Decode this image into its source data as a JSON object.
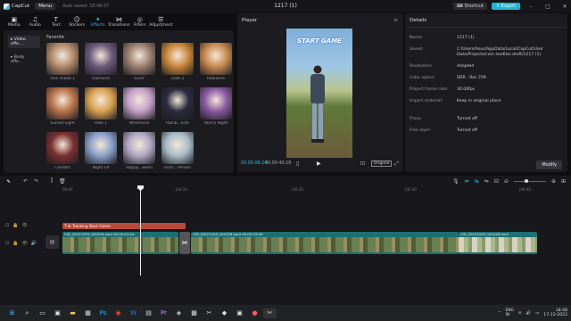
{
  "app": {
    "name": "CapCut",
    "menu_label": "Menu",
    "autosave": "Auto saved: 18:48:37",
    "window_title": "1217 (1)"
  },
  "titlebar": {
    "shortcut_label": "Shortcut",
    "export_label": "Export"
  },
  "toolbar": {
    "tools": [
      {
        "label": "Media",
        "icon": "media-icon"
      },
      {
        "label": "Audio",
        "icon": "audio-icon"
      },
      {
        "label": "Text",
        "icon": "text-icon"
      },
      {
        "label": "Stickers",
        "icon": "stickers-icon"
      },
      {
        "label": "Effects",
        "icon": "effects-icon",
        "active": true
      },
      {
        "label": "Transitions",
        "icon": "transitions-icon"
      },
      {
        "label": "Filters",
        "icon": "filters-icon"
      },
      {
        "label": "Adjustment",
        "icon": "adjustment-icon"
      }
    ]
  },
  "media_panel": {
    "side_items": [
      {
        "label": "▸ Video effe...",
        "active": true
      },
      {
        "label": "▸ Body effe...",
        "active": false
      }
    ],
    "section_title": "Favorite",
    "effects": [
      {
        "label": "Tree shade 1",
        "color": "#b28a6a"
      },
      {
        "label": "Diamond",
        "color": "#6b5a7a"
      },
      {
        "label": "\"Love\"",
        "color": "#9a7f6f"
      },
      {
        "label": "Leak 2",
        "color": "#c8863a"
      },
      {
        "label": "Radiance",
        "color": "#c98a52"
      },
      {
        "label": "Sunset Light",
        "color": "#b8724a"
      },
      {
        "label": "Halo 1",
        "color": "#d9a050"
      },
      {
        "label": "Whimsical",
        "color": "#c4a0c8"
      },
      {
        "label": "Rainb...ects",
        "color": "#2a2a3e"
      },
      {
        "label": "Starry Night",
        "color": "#8a5aa0"
      },
      {
        "label": "Confetti",
        "color": "#7a3030"
      },
      {
        "label": "Night Elf",
        "color": "#8aa0c8"
      },
      {
        "label": "Happy...ween",
        "color": "#b0a8c4"
      },
      {
        "label": "Instu...Person",
        "color": "#a8bcc8"
      }
    ]
  },
  "player": {
    "title": "Player",
    "video_text": "START GAME",
    "current_time": "00:00:06:24",
    "total_time": "00:00:40:28",
    "original_label": "Original"
  },
  "details": {
    "title": "Details",
    "rows": [
      {
        "key": "Name:",
        "value": "1217 (1)"
      },
      {
        "key": "Saved:",
        "value": "C:/Users/Asus/AppData/Local/CapCut/User Data/Projects/com.lveditor.draft/1217 (1)"
      },
      {
        "key": "Resolution:",
        "value": "Adapted"
      },
      {
        "key": "Color space:",
        "value": "SDR - Rec.709"
      },
      {
        "key": "Project frame rate:",
        "value": "30.00fps"
      },
      {
        "key": "Import material:",
        "value": "Keep in original place"
      },
      {
        "key": "Proxy:",
        "value": "Turned off"
      },
      {
        "key": "Free layer:",
        "value": "Turned off"
      }
    ],
    "modify_label": "Modify"
  },
  "timeline": {
    "ticks": [
      "00:00",
      "|00:10",
      "|00:20",
      "|00:30",
      "|00:40",
      "|00:50"
    ],
    "text_clip_label": "T ⚙ Tracking Start Game",
    "clips": [
      {
        "name": "VID_20221209_161028.mp4   00:00:01:04"
      },
      {
        "name": "VID_20221209_161028.mp4   00:00:25:09"
      },
      {
        "name": "VID_20221209_161028.mp4"
      }
    ]
  },
  "taskbar": {
    "language": "ENG",
    "region": "IN",
    "time": "18:48",
    "date": "17-12-2022"
  }
}
